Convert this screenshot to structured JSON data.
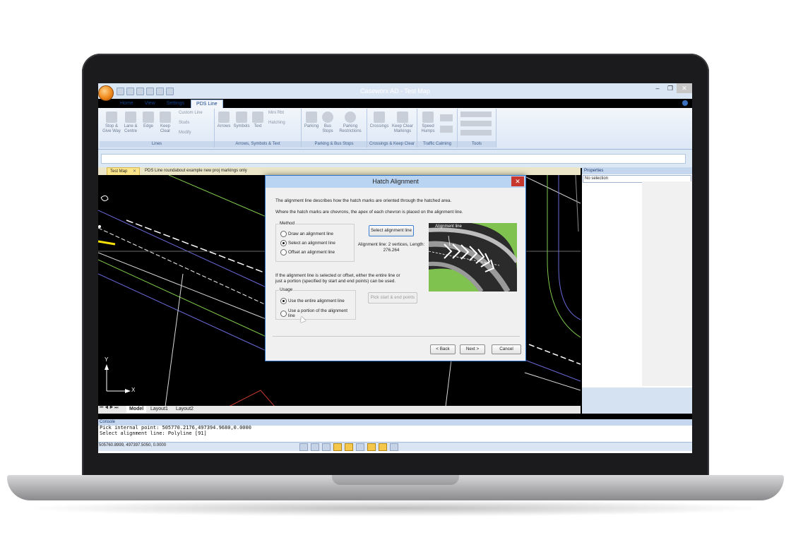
{
  "app": {
    "window_title": "Caseworx AD - Test Map",
    "ribbon_tabs": [
      "Home",
      "View",
      "Settings",
      "PDS Line"
    ],
    "active_tab": "PDS Line"
  },
  "ribbon": {
    "groups": [
      {
        "label": "Lines",
        "buttons": [
          "Stop & Give Way",
          "Lane & Centre",
          "Edge",
          "Keep Clear"
        ],
        "small": [
          "Custom Line",
          "Studs",
          "Modify"
        ]
      },
      {
        "label": "Arrows, Symbols & Text",
        "buttons": [
          "Arrows",
          "Symbols",
          "Text"
        ],
        "small": [
          "Mini Rbt",
          "Hatching"
        ]
      },
      {
        "label": "Parking & Bus Stops",
        "buttons": [
          "Parking",
          "Bus Stops",
          "Parking Restrictions"
        ]
      },
      {
        "label": "Crossings & Keep Clear",
        "buttons": [
          "Crossings",
          "Keep Clear Markings"
        ]
      },
      {
        "label": "Traffic Calming",
        "buttons": [
          "Speed Humps"
        ]
      },
      {
        "label": "Tools",
        "buttons": []
      }
    ]
  },
  "documents": {
    "tabs": [
      "Test Map",
      "PDS Line roundabout example new proj markings only"
    ]
  },
  "layout_tabs": [
    "Model",
    "Layout1",
    "Layout2"
  ],
  "axis_labels": {
    "y": "Y",
    "x": "X"
  },
  "properties": {
    "title": "Properties",
    "selection": "No selection"
  },
  "console": {
    "title": "Console",
    "lines": [
      "Pick internal point: 505770.2176,497394.9680,0.0000",
      "Select alignment line: Polyline [91]"
    ]
  },
  "status": {
    "coords": "505760.8999, 497397.5050, 0.0000"
  },
  "dialog": {
    "title": "Hatch Alignment",
    "intro1": "The alignment line describes how the hatch marks are oriented through the hatched area.",
    "intro2": "Where the hatch marks are chevrons, the apex of each chevron is placed on the alignment line.",
    "method_legend": "Method",
    "method_options": [
      "Draw an alignment line",
      "Select an alignment line",
      "Offset an alignment line"
    ],
    "method_selected": 1,
    "select_button": "Select alignment line",
    "alignment_info": "Alignment line: 2 vertices, Length: 276.264",
    "illustration_label": "Alignment line",
    "usage_intro": "If the alignment line is selected or offset, either the entire line or just a portion (specified by start and end points) can be used.",
    "usage_legend": "Usage",
    "usage_options": [
      "Use the entire alignment line",
      "Use a portion of the alignment line"
    ],
    "usage_selected": 0,
    "pick_button": "Pick start & end points",
    "back_button": "< Back",
    "next_button": "Next >",
    "cancel_button": "Cancel"
  },
  "colors": {
    "dialog_title": "#b9d4f2",
    "close_red": "#c8372d",
    "ribbon": "#dce7f5",
    "doc_tab": "#fbe48a"
  }
}
